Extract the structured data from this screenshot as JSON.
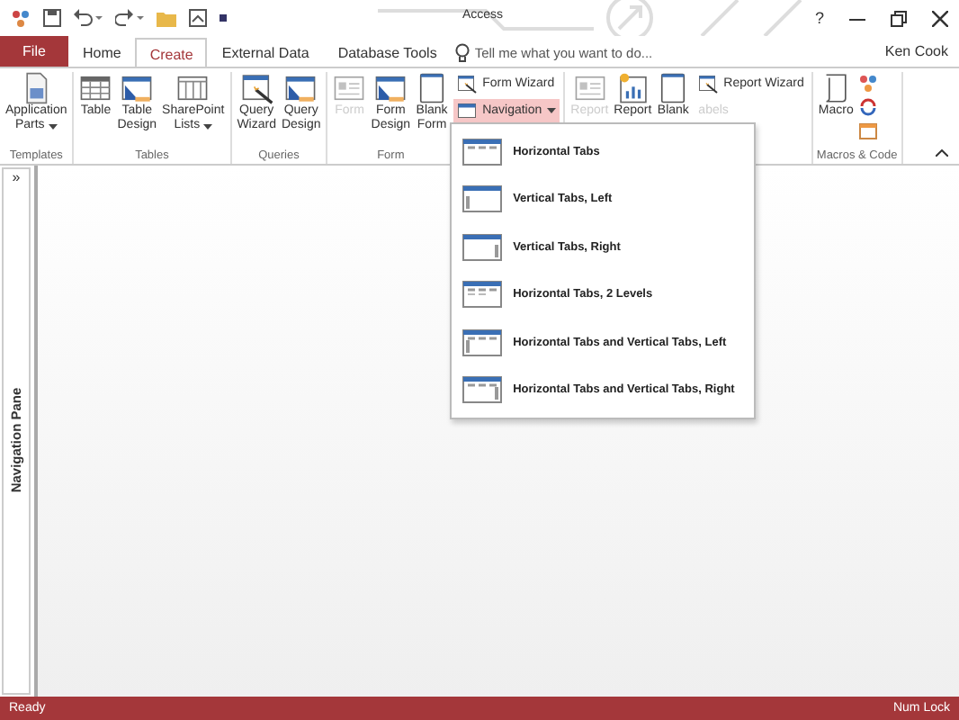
{
  "window": {
    "title": "Access",
    "help": "?",
    "user": "Ken Cook"
  },
  "tabs": [
    {
      "label": "File",
      "kind": "file",
      "selected": false
    },
    {
      "label": "Home",
      "kind": "tab",
      "selected": false
    },
    {
      "label": "Create",
      "kind": "tab",
      "selected": true
    },
    {
      "label": "External Data",
      "kind": "tab",
      "selected": false
    },
    {
      "label": "Database Tools",
      "kind": "tab",
      "selected": false
    }
  ],
  "tell_me": {
    "placeholder": "Tell me what you want to do..."
  },
  "ribbon_groups": [
    {
      "label": "Templates",
      "buttons": [
        {
          "kind": "large",
          "lines": [
            "Application",
            "Parts"
          ],
          "has_menu": true,
          "disabled": false
        }
      ]
    },
    {
      "label": "Tables",
      "buttons": [
        {
          "kind": "large",
          "lines": [
            "Table"
          ],
          "has_menu": false,
          "disabled": false
        },
        {
          "kind": "large",
          "lines": [
            "Table",
            "Design"
          ],
          "has_menu": false,
          "disabled": false
        },
        {
          "kind": "large",
          "lines": [
            "SharePoint",
            "Lists"
          ],
          "has_menu": true,
          "disabled": false
        }
      ]
    },
    {
      "label": "Queries",
      "buttons": [
        {
          "kind": "large",
          "lines": [
            "Query",
            "Wizard"
          ],
          "has_menu": false,
          "disabled": false
        },
        {
          "kind": "large",
          "lines": [
            "Query",
            "Design"
          ],
          "has_menu": false,
          "disabled": false
        }
      ]
    },
    {
      "label": "Form",
      "buttons": [
        {
          "kind": "large",
          "lines": [
            "Form"
          ],
          "has_menu": false,
          "disabled": true
        },
        {
          "kind": "large",
          "lines": [
            "Form",
            "Design"
          ],
          "has_menu": false,
          "disabled": false
        },
        {
          "kind": "large",
          "lines": [
            "Blank",
            "Form"
          ],
          "has_menu": false,
          "disabled": false
        },
        {
          "kind": "small",
          "lines": [
            "Form Wizard"
          ],
          "has_menu": false,
          "disabled": false,
          "selected": false
        },
        {
          "kind": "small",
          "lines": [
            "Navigation"
          ],
          "has_menu": true,
          "disabled": false,
          "selected": true
        }
      ]
    },
    {
      "buttons": [
        {
          "kind": "large",
          "lines": [
            "Report"
          ],
          "has_menu": false,
          "disabled": true
        },
        {
          "kind": "large",
          "lines": [
            "Report"
          ],
          "has_menu": false,
          "disabled": false
        },
        {
          "kind": "large",
          "lines": [
            "Blank"
          ],
          "has_menu": false,
          "disabled": false
        },
        {
          "kind": "small",
          "lines": [
            "Report Wizard"
          ],
          "has_menu": false,
          "disabled": false,
          "selected": false
        },
        {
          "kind": "small",
          "lines": [
            "abels"
          ],
          "has_menu": false,
          "disabled": true,
          "selected": false
        }
      ]
    },
    {
      "label": "Macros & Code",
      "buttons": [
        {
          "kind": "large",
          "lines": [
            "Macro"
          ],
          "has_menu": false,
          "disabled": false
        },
        {
          "kind": "iconstack"
        }
      ]
    }
  ],
  "navigation_menu": [
    {
      "label": "Horizontal Tabs"
    },
    {
      "label": "Vertical Tabs, Left"
    },
    {
      "label": "Vertical Tabs, Right"
    },
    {
      "label": "Horizontal Tabs, 2 Levels"
    },
    {
      "label": "Horizontal Tabs and Vertical Tabs, Left"
    },
    {
      "label": "Horizontal Tabs and Vertical Tabs, Right"
    }
  ],
  "navigation_pane": {
    "toggle": "»",
    "label": "Navigation Pane"
  },
  "status_bar": {
    "left": "Ready",
    "right": "Num Lock"
  }
}
